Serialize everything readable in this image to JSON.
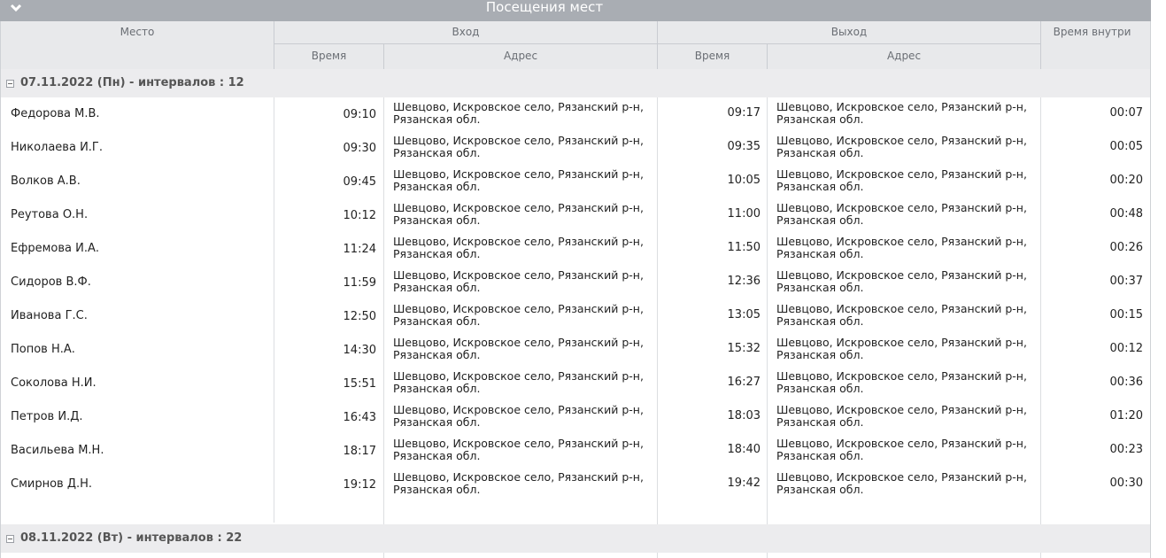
{
  "window": {
    "title": "Посещения мест"
  },
  "table": {
    "headers": {
      "place": "Место",
      "entry": "Вход",
      "exit": "Выход",
      "duration": "Время внутри",
      "time": "Время",
      "address": "Адрес"
    },
    "groups": [
      {
        "label": "07.11.2022 (Пн) - интервалов : 12",
        "expanded": true
      },
      {
        "label": "08.11.2022 (Вт) - интервалов : 22",
        "expanded": false
      }
    ],
    "rows": [
      {
        "name": "Федорова М.В.",
        "in_time": "09:10",
        "in_addr": "Шевцово, Искровское село, Рязанский р-н, Рязанская обл.",
        "out_time": "09:17",
        "out_addr": "Шевцово, Искровское село, Рязанский р-н, Рязанская обл.",
        "duration": "00:07"
      },
      {
        "name": "Николаева И.Г.",
        "in_time": "09:30",
        "in_addr": "Шевцово, Искровское село, Рязанский р-н, Рязанская обл.",
        "out_time": "09:35",
        "out_addr": "Шевцово, Искровское село, Рязанский р-н, Рязанская обл.",
        "duration": "00:05"
      },
      {
        "name": "Волков А.В.",
        "in_time": "09:45",
        "in_addr": "Шевцово, Искровское село, Рязанский р-н, Рязанская обл.",
        "out_time": "10:05",
        "out_addr": "Шевцово, Искровское село, Рязанский р-н, Рязанская обл.",
        "duration": "00:20"
      },
      {
        "name": "Реутова О.Н.",
        "in_time": "10:12",
        "in_addr": "Шевцово, Искровское село, Рязанский р-н, Рязанская обл.",
        "out_time": "11:00",
        "out_addr": "Шевцово, Искровское село, Рязанский р-н, Рязанская обл.",
        "duration": "00:48"
      },
      {
        "name": "Ефремова И.А.",
        "in_time": "11:24",
        "in_addr": "Шевцово, Искровское село, Рязанский р-н, Рязанская обл.",
        "out_time": "11:50",
        "out_addr": "Шевцово, Искровское село, Рязанский р-н, Рязанская обл.",
        "duration": "00:26"
      },
      {
        "name": "Сидоров В.Ф.",
        "in_time": "11:59",
        "in_addr": "Шевцово, Искровское село, Рязанский р-н, Рязанская обл.",
        "out_time": "12:36",
        "out_addr": "Шевцово, Искровское село, Рязанский р-н, Рязанская обл.",
        "duration": "00:37"
      },
      {
        "name": "Иванова Г.С.",
        "in_time": "12:50",
        "in_addr": "Шевцово, Искровское село, Рязанский р-н, Рязанская обл.",
        "out_time": "13:05",
        "out_addr": "Шевцово, Искровское село, Рязанский р-н, Рязанская обл.",
        "duration": "00:15"
      },
      {
        "name": "Попов Н.А.",
        "in_time": "14:30",
        "in_addr": "Шевцово, Искровское село, Рязанский р-н, Рязанская обл.",
        "out_time": "15:32",
        "out_addr": "Шевцово, Искровское село, Рязанский р-н, Рязанская обл.",
        "duration": "00:12"
      },
      {
        "name": "Соколова Н.И.",
        "in_time": "15:51",
        "in_addr": "Шевцово, Искровское село, Рязанский р-н, Рязанская обл.",
        "out_time": "16:27",
        "out_addr": "Шевцово, Искровское село, Рязанский р-н, Рязанская обл.",
        "duration": "00:36"
      },
      {
        "name": "Петров И.Д.",
        "in_time": "16:43",
        "in_addr": "Шевцово, Искровское село, Рязанский р-н, Рязанская обл.",
        "out_time": "18:03",
        "out_addr": "Шевцово, Искровское село, Рязанский р-н, Рязанская обл.",
        "duration": "01:20"
      },
      {
        "name": "Васильева М.Н.",
        "in_time": "18:17",
        "in_addr": "Шевцово, Искровское село, Рязанский р-н, Рязанская обл.",
        "out_time": "18:40",
        "out_addr": "Шевцово, Искровское село, Рязанский р-н, Рязанская обл.",
        "duration": "00:23"
      },
      {
        "name": "Смирнов Д.Н.",
        "in_time": "19:12",
        "in_addr": "Шевцово, Искровское село, Рязанский р-н, Рязанская обл.",
        "out_time": "19:42",
        "out_addr": "Шевцово, Искровское село, Рязанский р-н, Рязанская обл.",
        "duration": "00:30"
      }
    ]
  }
}
